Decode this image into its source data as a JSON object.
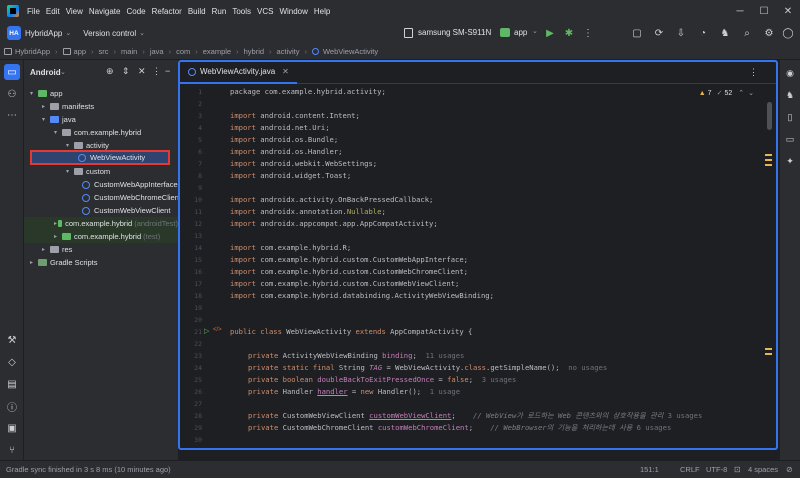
{
  "menu": [
    "File",
    "Edit",
    "View",
    "Navigate",
    "Code",
    "Refactor",
    "Build",
    "Run",
    "Tools",
    "VCS",
    "Window",
    "Help"
  ],
  "toolbar": {
    "project_badge": "HA",
    "project_name": "HybridApp",
    "vcs": "Version control",
    "device": "samsung SM-S911N",
    "run_config": "app"
  },
  "breadcrumbs": [
    "HybridApp",
    "app",
    "src",
    "main",
    "java",
    "com",
    "example",
    "hybrid",
    "activity",
    "WebViewActivity"
  ],
  "project_panel": {
    "view_selector": "Android",
    "tree": [
      {
        "label": "app",
        "kind": "module",
        "indent": 0
      },
      {
        "label": "manifests",
        "kind": "folder",
        "indent": 1
      },
      {
        "label": "java",
        "kind": "folder",
        "indent": 1
      },
      {
        "label": "com.example.hybrid",
        "kind": "package",
        "indent": 2
      },
      {
        "label": "activity",
        "kind": "package",
        "indent": 3
      },
      {
        "label": "WebViewActivity",
        "kind": "class",
        "indent": 4,
        "selected": true
      },
      {
        "label": "custom",
        "kind": "package",
        "indent": 3
      },
      {
        "label": "CustomWebAppInterface",
        "kind": "class",
        "indent": 4
      },
      {
        "label": "CustomWebChromeClient",
        "kind": "class",
        "indent": 4
      },
      {
        "label": "CustomWebViewClient",
        "kind": "class",
        "indent": 4
      },
      {
        "label": "com.example.hybrid",
        "kind": "package-test",
        "indent": 2,
        "suffix": "(androidTest)"
      },
      {
        "label": "com.example.hybrid",
        "kind": "package-test",
        "indent": 2,
        "suffix": "(test)"
      },
      {
        "label": "res",
        "kind": "folder",
        "indent": 1
      },
      {
        "label": "Gradle Scripts",
        "kind": "gradle",
        "indent": 0
      }
    ]
  },
  "editor": {
    "tab_label": "WebViewActivity.java",
    "warnings": "7",
    "weak_warnings": "52",
    "line_numbers": [
      "1",
      "2",
      "3",
      "4",
      "5",
      "6",
      "7",
      "8",
      "9",
      "10",
      "11",
      "12",
      "13",
      "14",
      "15",
      "16",
      "17",
      "18",
      "19",
      "20",
      "21",
      "22",
      "23",
      "24",
      "25",
      "26",
      "27",
      "28",
      "29",
      "30",
      "31"
    ]
  },
  "code": {
    "l1": "package com.example.hybrid.activity;",
    "l3_kw": "import",
    "l3": " android.content.Intent;",
    "l4_kw": "import",
    "l4": " android.net.Uri;",
    "l5_kw": "import",
    "l5": " android.os.Bundle;",
    "l6_kw": "import",
    "l6": " android.os.Handler;",
    "l7_kw": "import",
    "l7": " android.webkit.WebSettings;",
    "l8_kw": "import",
    "l8": " android.widget.Toast;",
    "l10_kw": "import",
    "l10": " androidx.activity.OnBackPressedCallback;",
    "l11_kw": "import",
    "l11a": " androidx.annotation.",
    "l11b": "Nullable",
    "l11c": ";",
    "l12_kw": "import",
    "l12": " androidx.appcompat.app.AppCompatActivity;",
    "l14_kw": "import",
    "l14": " com.example.hybrid.R;",
    "l15_kw": "import",
    "l15": " com.example.hybrid.custom.CustomWebAppInterface;",
    "l16_kw": "import",
    "l16": " com.example.hybrid.custom.CustomWebChromeClient;",
    "l17_kw": "import",
    "l17": " com.example.hybrid.custom.CustomWebViewClient;",
    "l18_kw": "import",
    "l18": " com.example.hybrid.databinding.ActivityWebViewBinding;",
    "l21_kw": "public class",
    "l21_name": " WebViewActivity ",
    "l21_kw2": "extends",
    "l21_rest": " AppCompatActivity {",
    "l23_kw": "private",
    "l23_type": " ActivityWebViewBinding ",
    "l23_field": "binding",
    "l23_end": ";",
    "l23_hint": "11 usages",
    "l24_kw": "private static final",
    "l24_type": " String ",
    "l24_field": "TAG",
    "l24_mid": " = WebViewActivity.",
    "l24_kw2": "class",
    "l24_end": ".getSimpleName();",
    "l24_hint": "no usages",
    "l25_kw": "private boolean",
    "l25_field": " doubleBackToExitPressedOnce",
    "l25_mid": " = ",
    "l25_kw2": "false",
    "l25_end": ";",
    "l25_hint": "3 usages",
    "l26_kw": "private",
    "l26_type": " Handler ",
    "l26_field": "handler",
    "l26_mid": " = ",
    "l26_kw2": "new",
    "l26_end": " Handler();",
    "l26_hint": "1 usage",
    "l28_kw": "private",
    "l28_type": " CustomWebViewClient ",
    "l28_field": "customWebViewClient",
    "l28_end": ";",
    "l28_cmt": "// WebView가 로드하는 Web 콘텐츠와의 상호작용을 관리",
    "l28_hint": "3 usages",
    "l29_kw": "private",
    "l29_type": " CustomWebChromeClient ",
    "l29_field": "customWebChromeClient",
    "l29_end": ";",
    "l29_cmt": "// WebBrowser의 기능을 처리하는데 사용",
    "l29_hint": "6 usages"
  },
  "status": {
    "message": "Gradle sync finished in 3 s 8 ms (10 minutes ago)",
    "position": "151:1",
    "line_sep": "CRLF",
    "encoding": "UTF-8",
    "indent": "4 spaces"
  },
  "colors": {
    "accent": "#3574f0",
    "selection_outline": "#e53935",
    "keyword": "#cf8e6d",
    "field": "#c77dbb"
  }
}
